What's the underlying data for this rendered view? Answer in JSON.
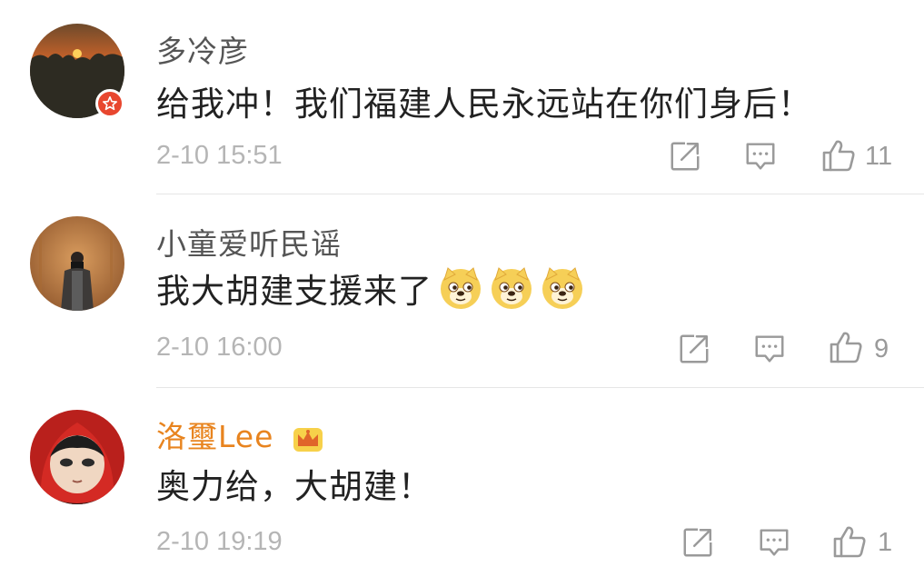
{
  "comments": [
    {
      "username": "多冷彦",
      "text": "给我冲！我们福建人民永远站在你们身后！",
      "timestamp": "2-10 15:51",
      "likes": "11",
      "avatar_icon": "sunset-avatar",
      "badge_icon": "star-badge-icon"
    },
    {
      "username": "小童爱听民谣",
      "text": "我大胡建支援来了",
      "emojis": [
        "doge-emoji",
        "doge-emoji",
        "doge-emoji"
      ],
      "timestamp": "2-10 16:00",
      "likes": "9",
      "avatar_icon": "person-photo-avatar"
    },
    {
      "username": "洛璽Lee",
      "username_color": "#e8841f",
      "text": "奥力给，大胡建！",
      "timestamp": "2-10 19:19",
      "likes": "1",
      "avatar_icon": "cartoon-avatar",
      "vip_icon": "crown-icon"
    }
  ],
  "actions": [
    "share-icon",
    "comment-icon",
    "like-icon"
  ]
}
